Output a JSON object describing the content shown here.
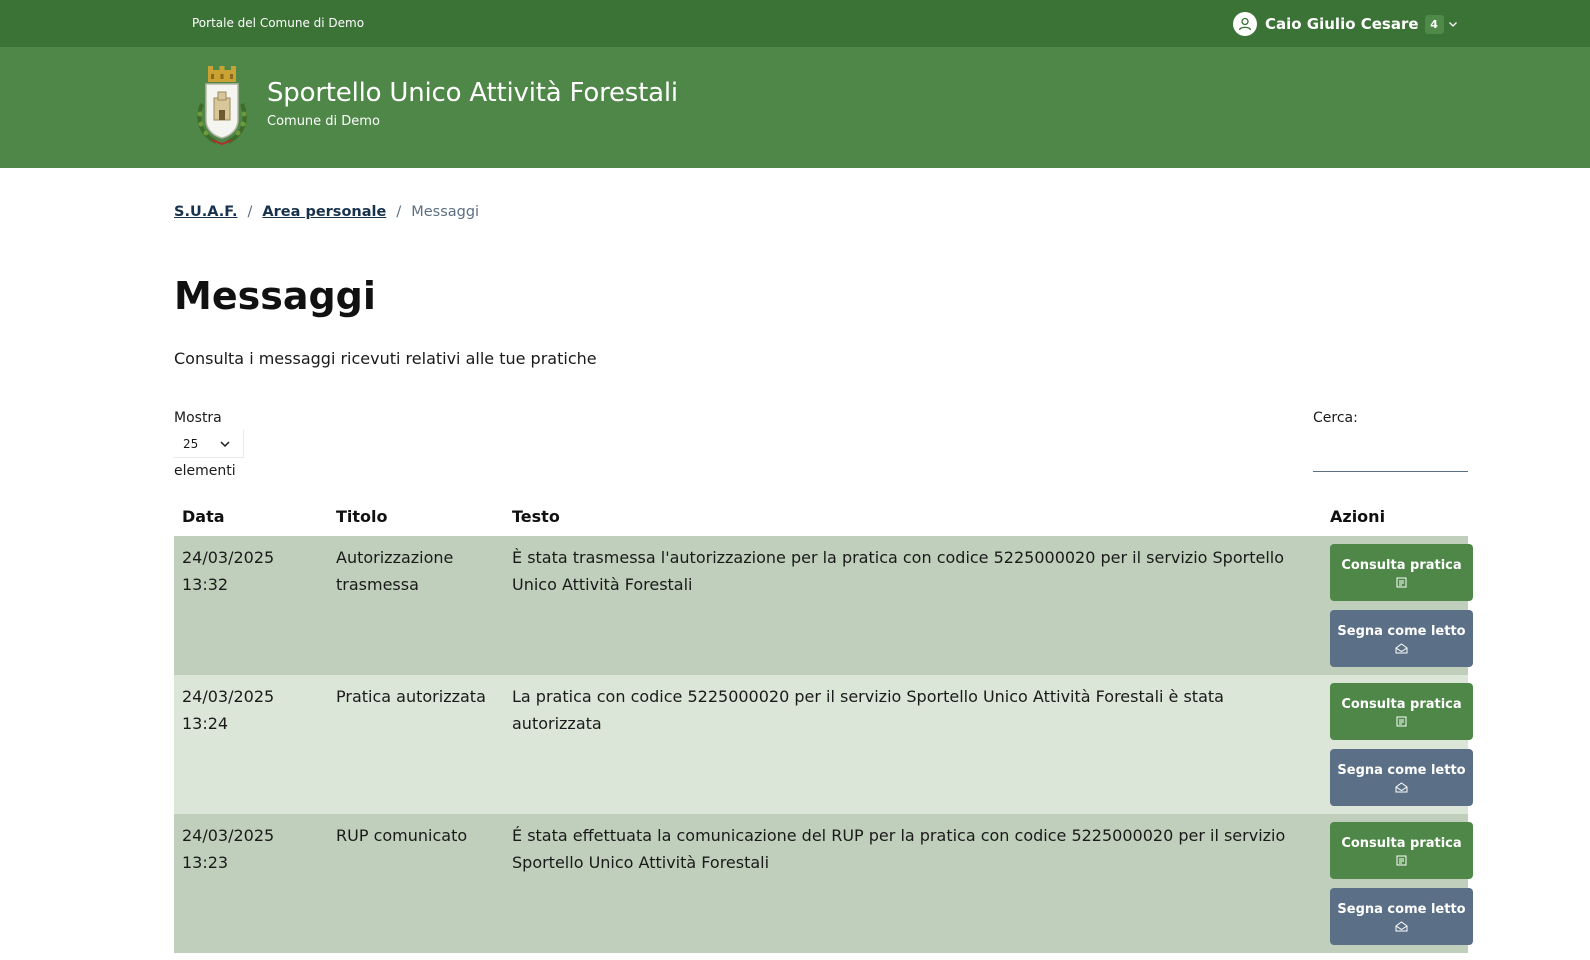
{
  "header": {
    "portal_link": "Portale del Comune di Demo",
    "user_name": "Caio Giulio Cesare",
    "notification_count": "4"
  },
  "site": {
    "title": "Sportello Unico Attività Forestali",
    "subtitle": "Comune di Demo"
  },
  "breadcrumb": {
    "items": [
      "S.U.A.F.",
      "Area personale"
    ],
    "current": "Messaggi",
    "separator": "/"
  },
  "page": {
    "title": "Messaggi",
    "lead": "Consulta i messaggi ricevuti relativi alle tue pratiche"
  },
  "table_controls": {
    "length_label": "Mostra",
    "length_value": "25",
    "length_suffix": "elementi",
    "search_label": "Cerca:",
    "search_value": ""
  },
  "table": {
    "columns": [
      "Data",
      "Titolo",
      "Testo",
      "Azioni"
    ],
    "rows": [
      {
        "date": "24/03/2025",
        "time": "13:32",
        "title": "Autorizzazione trasmessa",
        "text": "È stata trasmessa l'autorizzazione per la pratica con codice 5225000020 per il servizio Sportello Unico Attività Forestali"
      },
      {
        "date": "24/03/2025",
        "time": "13:24",
        "title": "Pratica autorizzata",
        "text": "La pratica con codice 5225000020 per il servizio Sportello Unico Attività Forestali è stata autorizzata"
      },
      {
        "date": "24/03/2025",
        "time": "13:23",
        "title": "RUP comunicato",
        "text": "É stata effettuata la comunicazione del RUP per la pratica con codice 5225000020 per il servizio Sportello Unico Attività Forestali"
      }
    ],
    "actions": {
      "view_label": "Consulta pratica",
      "mark_read_label": "Segna come letto"
    }
  },
  "colors": {
    "slim_header": "#3b7236",
    "header": "#4e8747",
    "row_odd": "#bfcfbb",
    "row_even": "#dce6d8",
    "button_primary": "#4e8747",
    "button_secondary": "#5b6f87"
  },
  "icons": {
    "user": "user-icon",
    "chevron": "chevron-down-icon",
    "document": "document-icon",
    "envelope": "envelope-open-icon",
    "crest": "crest-logo"
  }
}
